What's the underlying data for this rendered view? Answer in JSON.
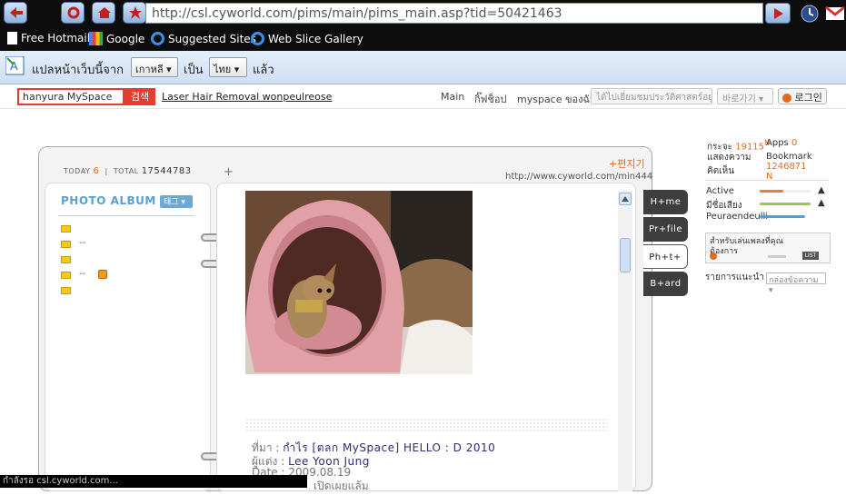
{
  "browser": {
    "url": "http://csl.cyworld.com/pims/main/pims_main.asp?tid=50421463",
    "favorites": [
      {
        "label": "Free Hotmail",
        "icon": "page-icon"
      },
      {
        "label": "Google",
        "icon": "google-icon"
      },
      {
        "label": "Suggested Sites",
        "icon": "ie-icon"
      },
      {
        "label": "Web Slice Gallery",
        "icon": "ie-icon"
      }
    ],
    "status": "กำลังรอ csl.cyworld.com..."
  },
  "translate_bar": {
    "prefix": "แปลหน้าเว็บนี้จาก",
    "from_lang": "เกาหลี",
    "middle": "เป็น",
    "to_lang": "ไทย",
    "suffix": "แล้ว"
  },
  "cy_bar": {
    "search_value": "hanyura MySpace",
    "search_button": "검색",
    "ad_text": "Laser Hair Removal wonpeulreose",
    "links": [
      "Main",
      "กิ๊ฟช็อป",
      "myspace ของฉัน"
    ],
    "history_btn": "ได้ไปเยี่ยมชมประวัติศาสตร์อยู่",
    "shortcut_btn": "바로가기",
    "login": "로그인"
  },
  "hompy": {
    "today_label": "TODAY",
    "today_value": "6",
    "total_label": "TOTAL",
    "total_value": "17544783",
    "edit_label": "편지기",
    "home_url": "http://www.cyworld.com/min444",
    "album_title": "PHOTO ALBUM",
    "tag_button": "태그",
    "folders": [
      "",
      "--",
      "",
      "--",
      ""
    ],
    "tabs": [
      "H+me",
      "Pr+file",
      "Ph+t+",
      "B+ard"
    ],
    "active_tab": "Ph+t+",
    "post": {
      "source_label": "ที่มา :",
      "source_value": "กำไร [ตลก MySpace] HELLO : D 2010",
      "author_label": "ผู้แต่ง :",
      "author_value": "Lee Yoon Jung",
      "date_label": "Date :",
      "date_value": "2009.08.19",
      "extra": "เปิดเผยแล้ม"
    }
  },
  "sidebar": {
    "mood_label": "กระจะ",
    "mood_value": "19115",
    "apps_label": "Apps",
    "apps_value": "0",
    "comments_label": "แสดงความคิดเห็น",
    "bookmark_label": "Bookmark",
    "bookmark_value": "1246871",
    "stats": [
      "Active",
      "มีชื่อเสียง",
      "Peuraendeulli"
    ],
    "music_text": "สำหรับเล่นเพลงที่คุณต้องการ",
    "recommend_label": "รายการแนะนำ",
    "recommend_select": "กล่องข้อความ"
  },
  "colors": {
    "accent": "#e06b1f",
    "search_red": "#e43d2f",
    "album_blue": "#5a9fce"
  }
}
